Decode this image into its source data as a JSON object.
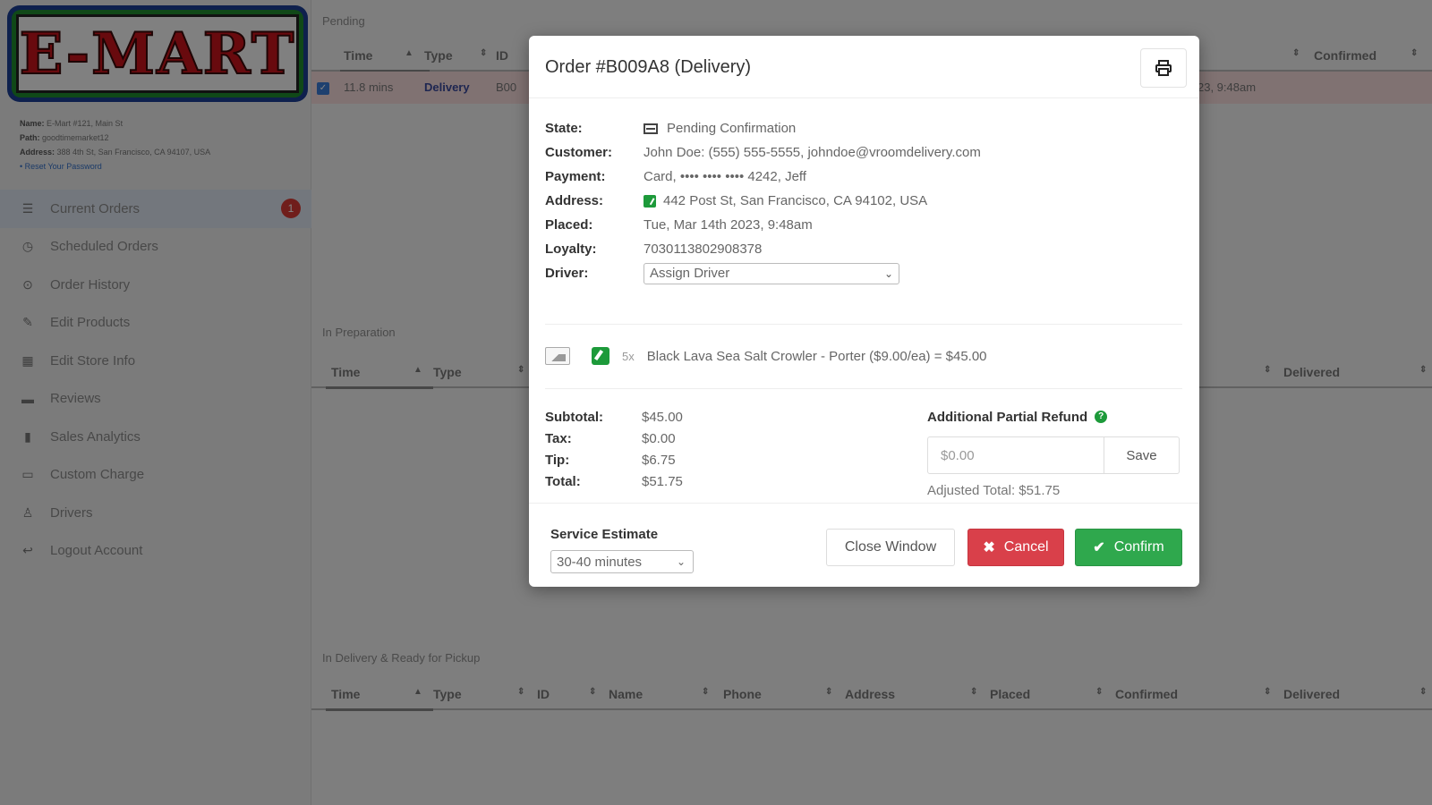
{
  "sidebar": {
    "logo_text": "E-MART",
    "store_info": {
      "name_label": "Name:",
      "name_value": "E-Mart #121, Main St",
      "path_label": "Path:",
      "path_value": "goodtimemarket12",
      "address_label": "Address:",
      "address_value": "388 4th St, San Francisco, CA 94107, USA",
      "reset_link": "Reset Your Password"
    },
    "nav": [
      {
        "label": "Current Orders",
        "icon": "list-icon",
        "badge": "1"
      },
      {
        "label": "Scheduled Orders",
        "icon": "clock-icon"
      },
      {
        "label": "Order History",
        "icon": "history-icon"
      },
      {
        "label": "Edit Products",
        "icon": "edit-icon"
      },
      {
        "label": "Edit Store Info",
        "icon": "store-icon"
      },
      {
        "label": "Reviews",
        "icon": "comment-icon"
      },
      {
        "label": "Sales Analytics",
        "icon": "bar-chart-icon"
      },
      {
        "label": "Custom Charge",
        "icon": "credit-card-icon"
      },
      {
        "label": "Drivers",
        "icon": "drivers-icon"
      },
      {
        "label": "Logout Account",
        "icon": "logout-icon"
      }
    ]
  },
  "main": {
    "pending": {
      "label": "Pending",
      "headers": [
        "Time",
        "Type",
        "ID",
        "Confirmed"
      ],
      "row": {
        "time": "11.8 mins",
        "type": "Delivery",
        "id": "B00",
        "timestamp_fragment": "23, 9:48am"
      }
    },
    "in_preparation": {
      "label": "In Preparation",
      "headers": [
        "Time",
        "Type",
        "Delivered"
      ]
    },
    "in_delivery": {
      "label": "In Delivery & Ready for Pickup",
      "headers": [
        "Time",
        "Type",
        "ID",
        "Name",
        "Phone",
        "Address",
        "Placed",
        "Confirmed",
        "Delivered"
      ]
    }
  },
  "modal": {
    "title": "Order #B009A8 (Delivery)",
    "details": [
      {
        "label": "State:",
        "value": "Pending Confirmation"
      },
      {
        "label": "Customer:",
        "value": "John Doe: (555) 555-5555, johndoe@vroomdelivery.com"
      },
      {
        "label": "Payment:",
        "value": "Card, •••• •••• •••• 4242, Jeff"
      },
      {
        "label": "Address:",
        "value": "442 Post St, San Francisco, CA 94102, USA"
      },
      {
        "label": "Placed:",
        "value": "Tue, Mar 14th 2023, 9:48am"
      },
      {
        "label": "Loyalty:",
        "value": "7030113802908378"
      },
      {
        "label": "Driver:",
        "value": "Assign Driver"
      }
    ],
    "item": {
      "qty": "5x",
      "description": "Black Lava Sea Salt Crowler - Porter ($9.00/ea) = $45.00"
    },
    "totals": [
      {
        "label": "Subtotal:",
        "value": "$45.00"
      },
      {
        "label": "Tax:",
        "value": "$0.00"
      },
      {
        "label": "Tip:",
        "value": "$6.75"
      },
      {
        "label": "Total:",
        "value": "$51.75"
      }
    ],
    "refund": {
      "title": "Additional Partial Refund",
      "input_value": "$0.00",
      "save_label": "Save",
      "adjusted_total": "Adjusted Total: $51.75"
    },
    "footer": {
      "service_label": "Service Estimate",
      "service_value": "30-40 minutes",
      "close_label": "Close Window",
      "cancel_label": "Cancel",
      "confirm_label": "Confirm"
    }
  },
  "colors": {
    "cancel": "#d9404a",
    "confirm": "#2fa84d",
    "badge": "#d63a34",
    "logo_red": "#c8141b"
  }
}
